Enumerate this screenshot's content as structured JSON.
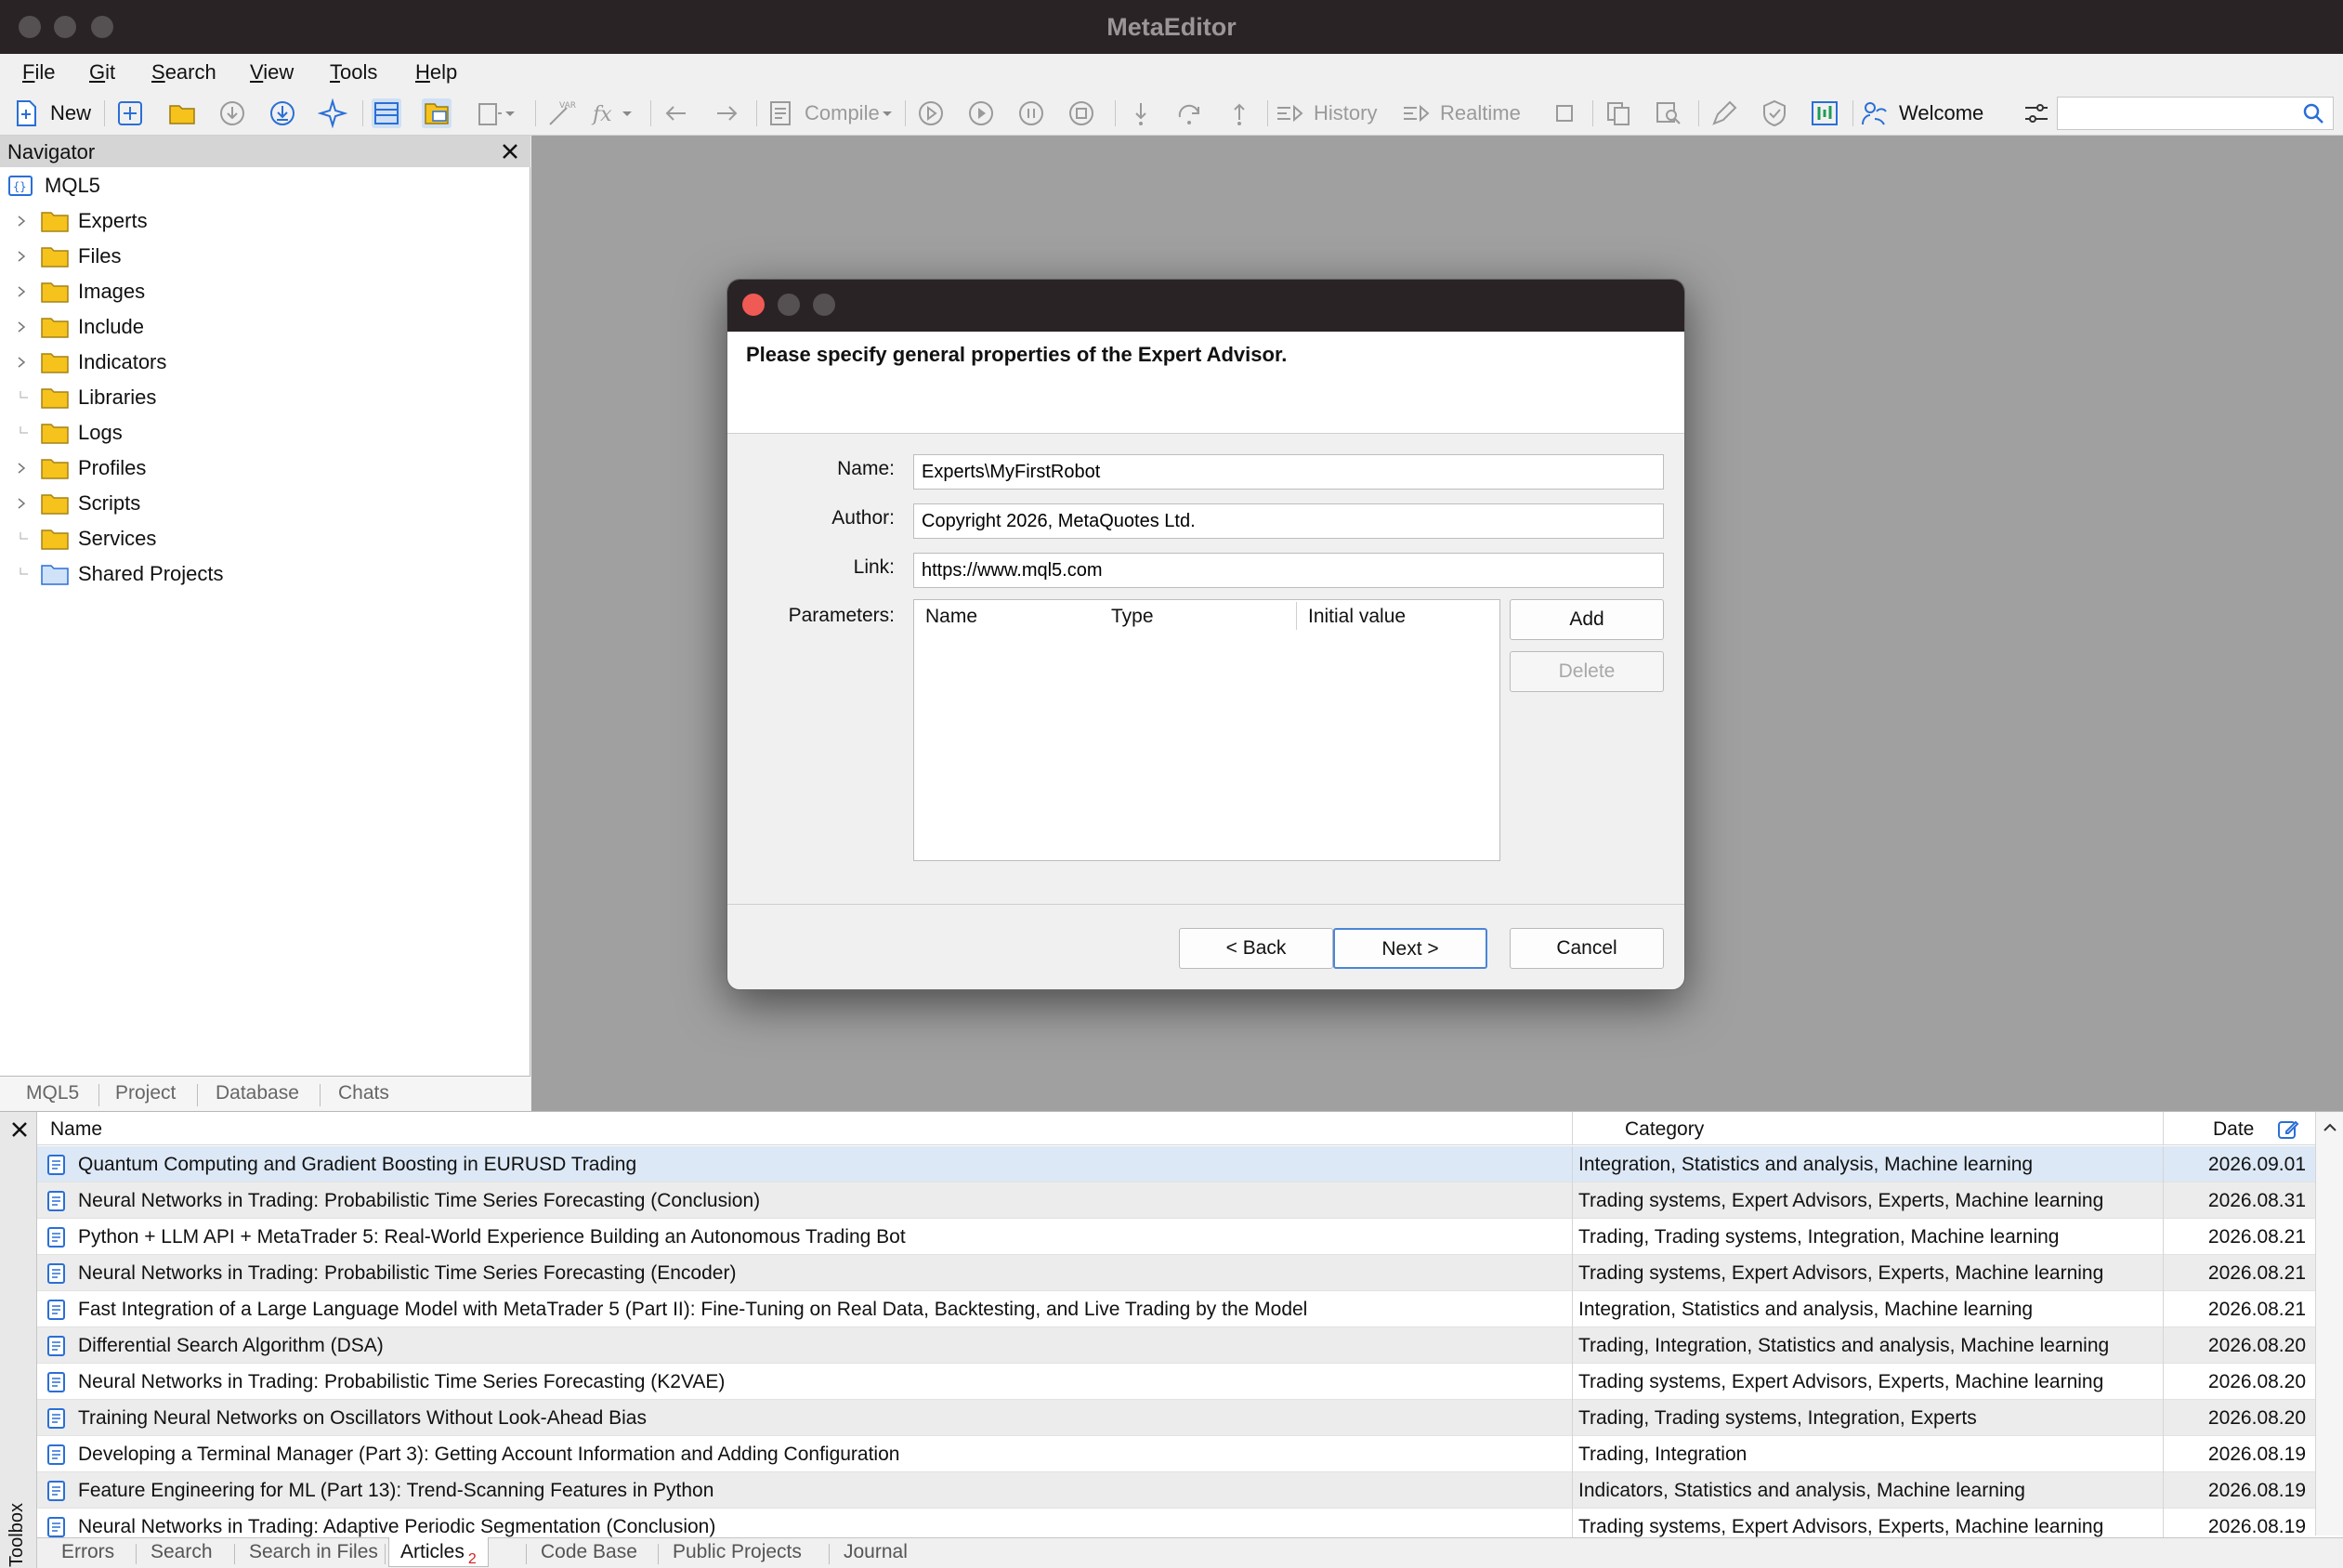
{
  "window": {
    "title": "MetaEditor"
  },
  "menubar": {
    "items": [
      "File",
      "Git",
      "Search",
      "View",
      "Tools",
      "Help"
    ]
  },
  "toolbar": {
    "new_label": "New",
    "compile_label": "Compile",
    "history_label": "History",
    "realtime_label": "Realtime",
    "welcome_label": "Welcome",
    "var_label": "VAR",
    "fx_label": "fx",
    "search_value": "",
    "colors": {
      "accent": "#2a6fd6",
      "folder": "#f6c21c",
      "green": "#1e9b57"
    }
  },
  "navigator": {
    "title": "Navigator",
    "root": "MQL5",
    "items": [
      {
        "label": "Experts",
        "expandable": true,
        "icon": "folder-icon"
      },
      {
        "label": "Files",
        "expandable": true,
        "icon": "folder-icon"
      },
      {
        "label": "Images",
        "expandable": true,
        "icon": "folder-icon"
      },
      {
        "label": "Include",
        "expandable": true,
        "icon": "folder-icon"
      },
      {
        "label": "Indicators",
        "expandable": true,
        "icon": "folder-icon"
      },
      {
        "label": "Libraries",
        "expandable": false,
        "icon": "folder-icon"
      },
      {
        "label": "Logs",
        "expandable": false,
        "icon": "folder-icon"
      },
      {
        "label": "Profiles",
        "expandable": true,
        "icon": "folder-icon"
      },
      {
        "label": "Scripts",
        "expandable": true,
        "icon": "folder-icon"
      },
      {
        "label": "Services",
        "expandable": false,
        "icon": "folder-icon"
      },
      {
        "label": "Shared Projects",
        "expandable": false,
        "icon": "shared-folder-icon"
      }
    ],
    "tabs": [
      "MQL5",
      "Project",
      "Database",
      "Chats"
    ]
  },
  "dialog": {
    "heading": "Please specify general properties of the Expert Advisor.",
    "name_label": "Name:",
    "name_value": "Experts\\MyFirstRobot",
    "author_label": "Author:",
    "author_value": "Copyright 2026, MetaQuotes Ltd.",
    "link_label": "Link:",
    "link_value": "https://www.mql5.com",
    "parameters_label": "Parameters:",
    "param_columns": [
      "Name",
      "Type",
      "Initial value"
    ],
    "add_label": "Add",
    "delete_label": "Delete",
    "back_label": "< Back",
    "next_label": "Next >",
    "cancel_label": "Cancel"
  },
  "toolbox": {
    "side_label": "Toolbox",
    "columns": {
      "name": "Name",
      "category": "Category",
      "date": "Date"
    },
    "rows": [
      {
        "name": "Quantum Computing and Gradient Boosting in EURUSD Trading",
        "category": "Integration, Statistics and analysis, Machine learning",
        "date": "2026.09.01"
      },
      {
        "name": "Neural Networks in Trading: Probabilistic Time Series Forecasting (Conclusion)",
        "category": "Trading systems, Expert Advisors, Experts, Machine learning",
        "date": "2026.08.31"
      },
      {
        "name": "Python + LLM API + MetaTrader 5: Real-World Experience Building an Autonomous Trading Bot",
        "category": "Trading, Trading systems, Integration, Machine learning",
        "date": "2026.08.21"
      },
      {
        "name": "Neural Networks in Trading: Probabilistic Time Series Forecasting (Encoder)",
        "category": "Trading systems, Expert Advisors, Experts, Machine learning",
        "date": "2026.08.21"
      },
      {
        "name": "Fast Integration of a Large Language Model with MetaTrader 5 (Part II): Fine-Tuning on Real Data, Backtesting, and Live Trading by the Model",
        "category": "Integration, Statistics and analysis, Machine learning",
        "date": "2026.08.21"
      },
      {
        "name": "Differential Search Algorithm (DSA)",
        "category": "Trading, Integration, Statistics and analysis, Machine learning",
        "date": "2026.08.20"
      },
      {
        "name": "Neural Networks in Trading: Probabilistic Time Series Forecasting (K2VAE)",
        "category": "Trading systems, Expert Advisors, Experts, Machine learning",
        "date": "2026.08.20"
      },
      {
        "name": "Training Neural Networks on Oscillators Without Look-Ahead Bias",
        "category": "Trading, Trading systems, Integration, Experts",
        "date": "2026.08.20"
      },
      {
        "name": "Developing a Terminal Manager (Part 3): Getting Account Information and Adding Configuration",
        "category": "Trading, Integration",
        "date": "2026.08.19"
      },
      {
        "name": "Feature Engineering for ML (Part 13): Trend-Scanning Features in Python",
        "category": "Indicators, Statistics and analysis, Machine learning",
        "date": "2026.08.19"
      },
      {
        "name": "Neural Networks in Trading: Adaptive Periodic Segmentation (Conclusion)",
        "category": "Trading systems, Expert Advisors, Experts, Machine learning",
        "date": "2026.08.19"
      }
    ],
    "tabs": [
      {
        "label": "Errors"
      },
      {
        "label": "Search"
      },
      {
        "label": "Search in Files"
      },
      {
        "label": "Articles",
        "badge": "2"
      },
      {
        "label": "Code Base"
      },
      {
        "label": "Public Projects"
      },
      {
        "label": "Journal"
      }
    ]
  }
}
